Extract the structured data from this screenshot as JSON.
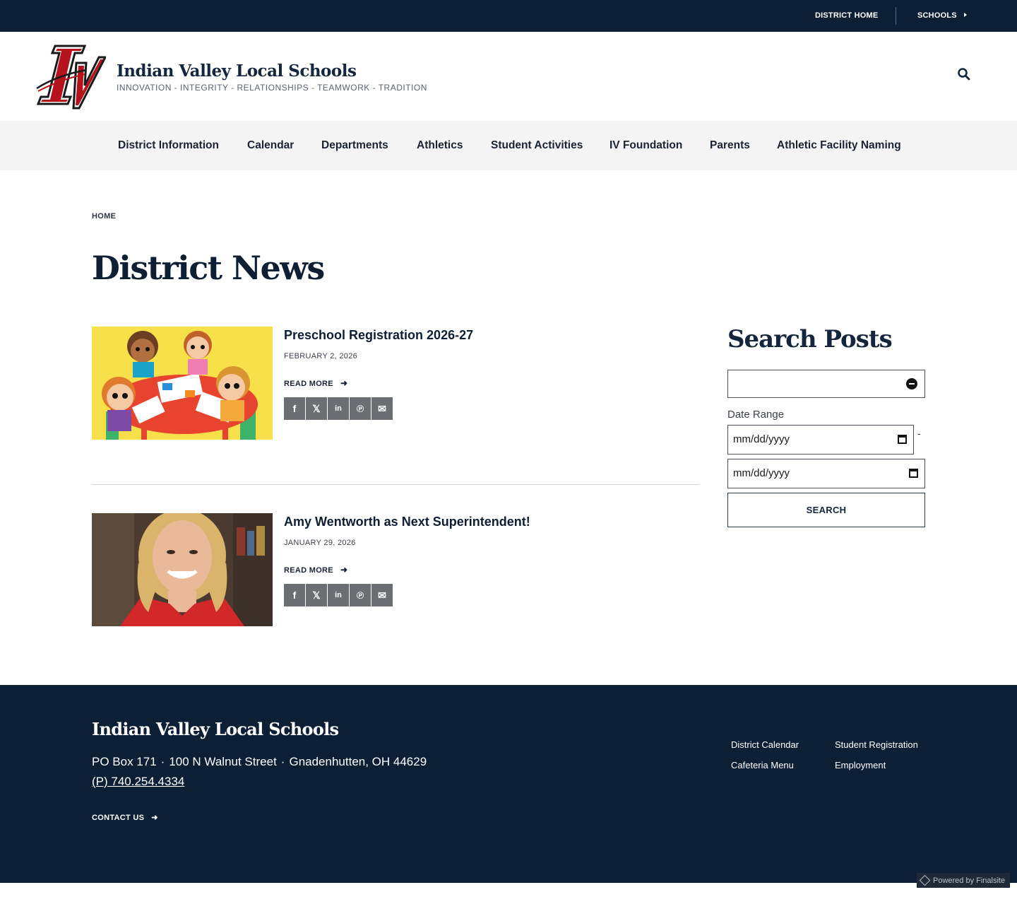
{
  "topbar": {
    "district_home": "DISTRICT HOME",
    "schools": "SCHOOLS"
  },
  "header": {
    "title": "Indian Valley Local Schools",
    "tagline": "INNOVATION - INTEGRITY - RELATIONSHIPS - TEAMWORK - TRADITION",
    "logo_text": "IV",
    "search_icon": "search-icon"
  },
  "nav": {
    "items": [
      {
        "label": "District Information"
      },
      {
        "label": "Calendar"
      },
      {
        "label": "Departments"
      },
      {
        "label": "Athletics"
      },
      {
        "label": "Student Activities"
      },
      {
        "label": "IV Foundation"
      },
      {
        "label": "Parents"
      },
      {
        "label": "Athletic Facility Naming"
      }
    ]
  },
  "breadcrumb": "HOME",
  "page_title": "District News",
  "posts": [
    {
      "title": "Preschool Registration 2026-27",
      "date": "FEBRUARY 2, 2026",
      "read_more": "READ MORE"
    },
    {
      "title": "Amy Wentworth as Next Superintendent!",
      "date": "JANUARY 29, 2026",
      "read_more": "READ MORE"
    }
  ],
  "share_icons": [
    "facebook-icon",
    "x-icon",
    "linkedin-icon",
    "pinterest-icon",
    "email-icon"
  ],
  "sidebar": {
    "title": "Search Posts",
    "keyword_value": "",
    "date_range_label": "Date Range",
    "date_placeholder": "mm/dd/yyyy",
    "date_separator": "-",
    "search_button": "SEARCH"
  },
  "footer": {
    "title": "Indian Valley Local Schools",
    "po_box": "PO Box 171",
    "street": "100 N Walnut Street",
    "city": "Gnadenhutten, OH  44629",
    "phone": "(P) 740.254.4334",
    "contact": "CONTACT US",
    "links": {
      "district_calendar": "District Calendar",
      "student_registration": "Student Registration",
      "cafeteria_menu": "Cafeteria Menu",
      "employment": "Employment"
    },
    "powered": "Powered by Finalsite"
  },
  "colors": {
    "navy": "#0d1f35",
    "brand_red": "#b5121b",
    "nav_bg": "#f4f4f4",
    "share_gray": "#6b6e72"
  }
}
